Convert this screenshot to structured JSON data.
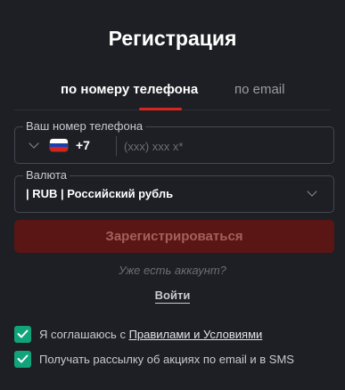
{
  "title": "Регистрация",
  "tabs": [
    {
      "label": "по номеру телефона",
      "active": true
    },
    {
      "label": "по email",
      "active": false
    }
  ],
  "phone": {
    "legend": "Ваш номер телефона",
    "country_code": "+7",
    "placeholder": "(xxx) xxx x*",
    "flag_icon": "russia-flag-icon"
  },
  "currency": {
    "legend": "Валюта",
    "value": "| RUB | Российский рубль"
  },
  "register_button": "Зарегистрироваться",
  "have_account": "Уже есть аккаунт?",
  "login_link": "Войти",
  "agreements": [
    {
      "prefix": "Я соглашаюсь с ",
      "link": "Правилами и Условиями",
      "checked": true
    },
    {
      "text": "Получать рассылку об акциях по email и в SMS",
      "checked": true
    }
  ],
  "colors": {
    "background": "#1e1f24",
    "accent_red": "#d7261e",
    "button_disabled": "#5a1614",
    "checkbox_green": "#11a37a"
  }
}
